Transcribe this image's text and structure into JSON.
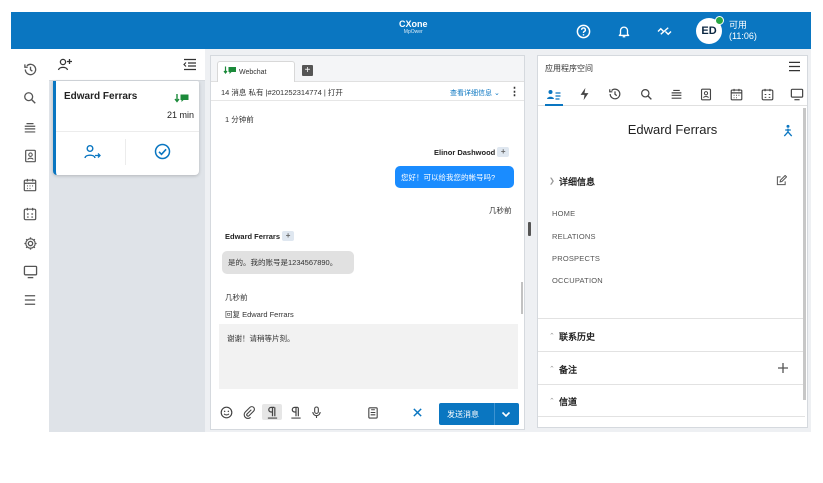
{
  "topbar": {
    "brand_line1": "CXone",
    "brand_line2": "MpOwer",
    "avatar_initials": "ED",
    "status_label": "可用",
    "status_time": "(11:06)"
  },
  "contacts": {
    "card": {
      "name": "Edward Ferrars",
      "elapsed": "21 min"
    }
  },
  "chat": {
    "tab_label": "Webchat",
    "info": "14 消息 私有 |#201252314774 | 打开",
    "details_link": "查看详细信息",
    "messages": {
      "ts1": "1 分钟前",
      "agent_name": "Elinor Dashwood",
      "agent_msg": "您好！可以给我您的帐号吗?",
      "ts2": "几秒前",
      "customer_name": "Edward Ferrars",
      "customer_msg": "是的。我的账号是1234567890。",
      "ts3": "几秒前"
    },
    "reply_label": "回复 Edward Ferrars",
    "compose_text": "谢谢！请稍等片刻。",
    "send_label": "发送消息"
  },
  "appspace": {
    "title": "应用程序空间",
    "contact_name": "Edward Ferrars",
    "details_section": "详细信息",
    "details_items": [
      "HOME",
      "RELATIONS",
      "PROSPECTS",
      "OCCUPATION"
    ],
    "history_section": "联系历史",
    "notes_section": "备注",
    "channels_section": "信道"
  },
  "colors": {
    "brand_blue": "#0a76c1",
    "bubble_blue": "#1a8cff",
    "status_green": "#28a745"
  }
}
